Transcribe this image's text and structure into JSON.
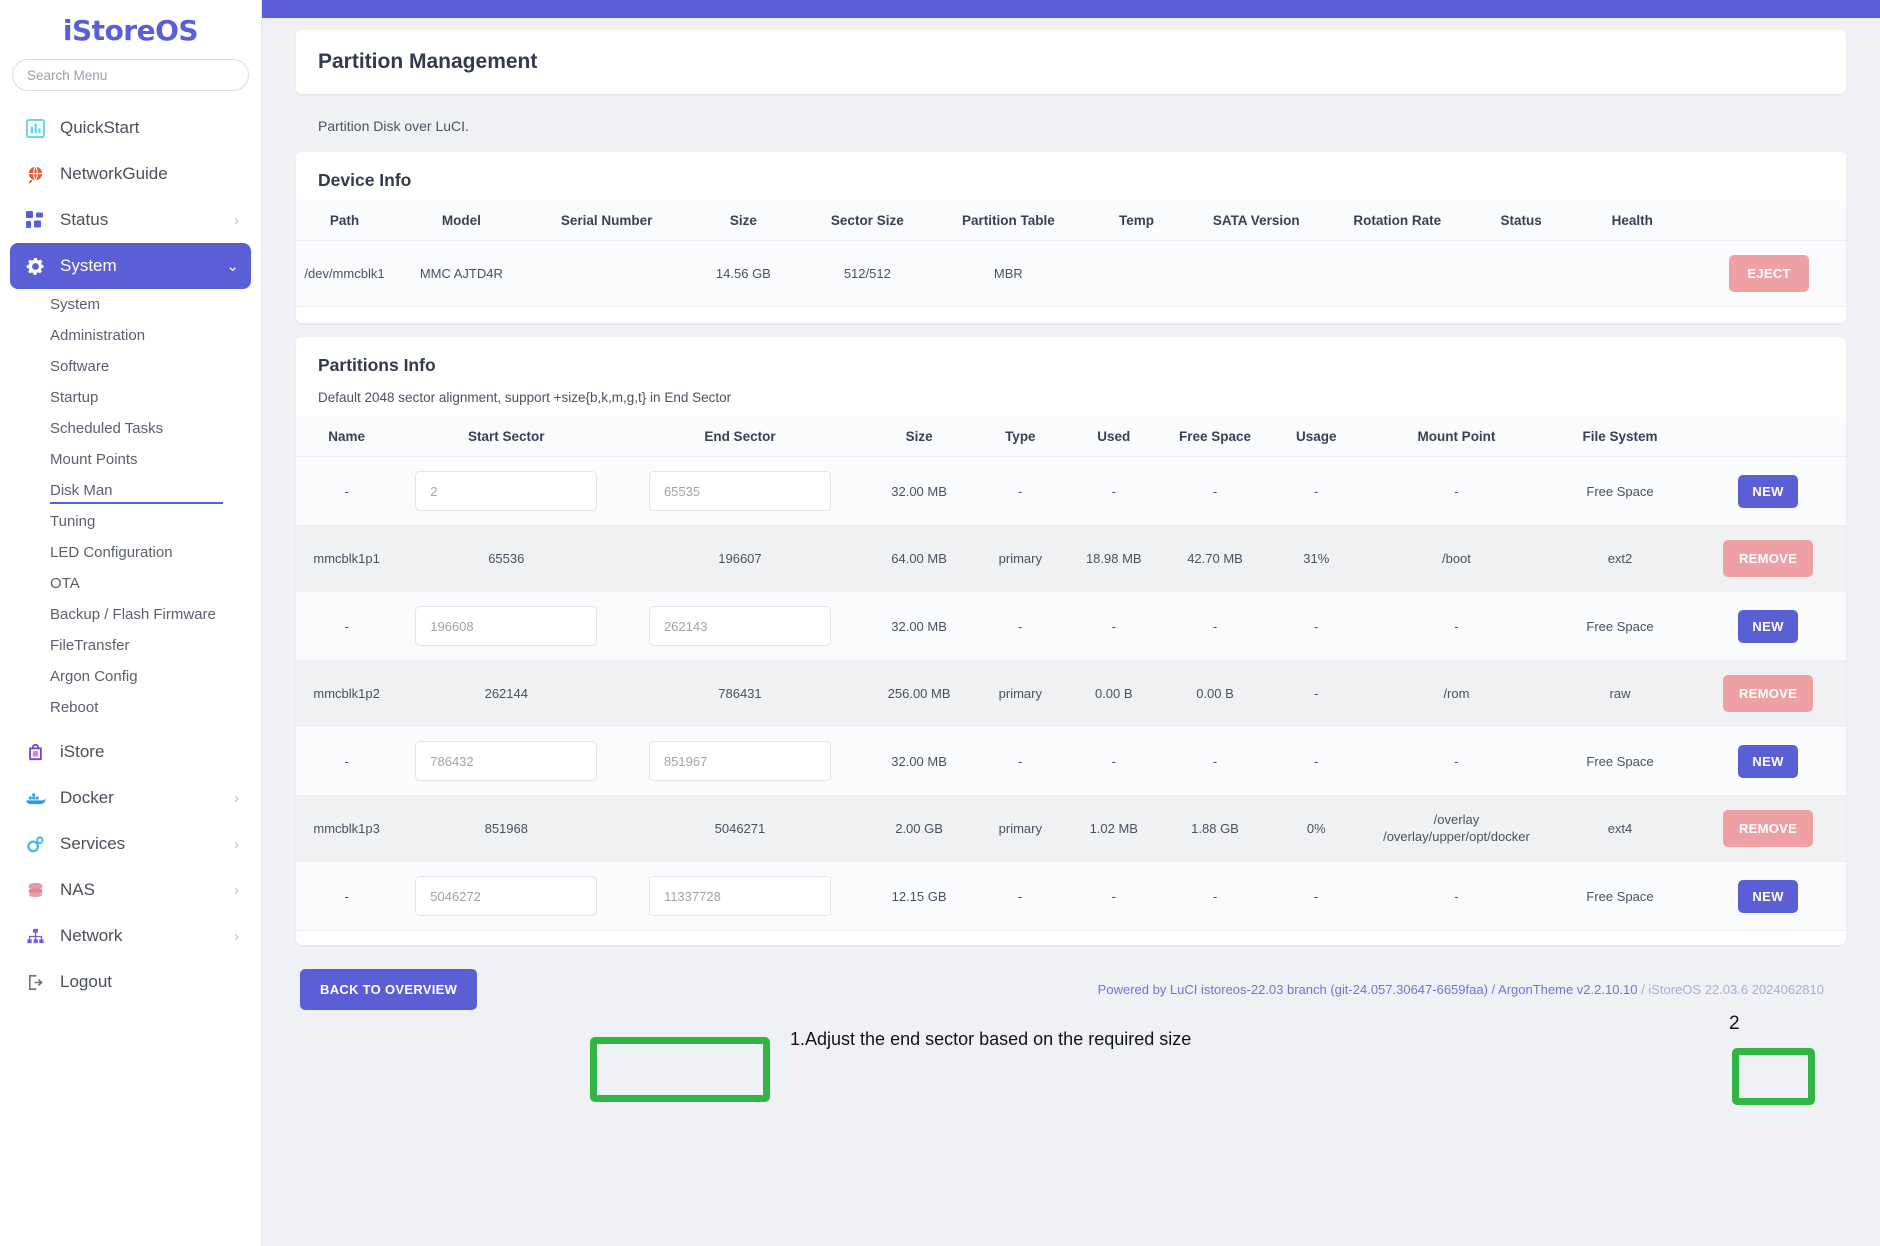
{
  "brand": {
    "logo": "iStoreOS"
  },
  "sidebar": {
    "search_placeholder": "Search Menu",
    "items": [
      {
        "label": "QuickStart",
        "icon": "chart-icon",
        "chevron": ""
      },
      {
        "label": "NetworkGuide",
        "icon": "globe-icon",
        "chevron": ""
      },
      {
        "label": "Status",
        "icon": "grid-icon",
        "chevron": "›"
      },
      {
        "label": "System",
        "icon": "gear-icon",
        "chevron": "⌄",
        "active": true
      }
    ],
    "sub_items": [
      "System",
      "Administration",
      "Software",
      "Startup",
      "Scheduled Tasks",
      "Mount Points",
      "Disk Man",
      "Tuning",
      "LED Configuration",
      "OTA",
      "Backup / Flash Firmware",
      "FileTransfer",
      "Argon Config",
      "Reboot"
    ],
    "selected_sub": "Disk Man",
    "bottom_items": [
      {
        "label": "iStore",
        "icon": "bag-icon",
        "chevron": ""
      },
      {
        "label": "Docker",
        "icon": "docker-icon",
        "chevron": "›"
      },
      {
        "label": "Services",
        "icon": "gears-icon",
        "chevron": "›"
      },
      {
        "label": "NAS",
        "icon": "database-icon",
        "chevron": "›"
      },
      {
        "label": "Network",
        "icon": "sitemap-icon",
        "chevron": "›"
      },
      {
        "label": "Logout",
        "icon": "logout-icon",
        "chevron": ""
      }
    ]
  },
  "page": {
    "title": "Partition Management",
    "description": "Partition Disk over LuCI."
  },
  "device_info": {
    "title": "Device Info",
    "columns": [
      "Path",
      "Model",
      "Serial Number",
      "Size",
      "Sector Size",
      "Partition Table",
      "Temp",
      "SATA Version",
      "Rotation Rate",
      "Status",
      "Health"
    ],
    "rows": [
      {
        "path": "/dev/mmcblk1",
        "model": "MMC AJTD4R",
        "serial": "",
        "size": "14.56 GB",
        "sector_size": "512/512",
        "partition_table": "MBR",
        "temp": "",
        "sata_version": "",
        "rotation_rate": "",
        "status": "",
        "health": "",
        "action": "EJECT"
      }
    ]
  },
  "partitions_info": {
    "title": "Partitions Info",
    "note": "Default 2048 sector alignment, support +size{b,k,m,g,t} in End Sector",
    "columns": [
      "Name",
      "Start Sector",
      "End Sector",
      "Size",
      "Type",
      "Used",
      "Free Space",
      "Usage",
      "Mount Point",
      "File System"
    ],
    "rows": [
      {
        "kind": "free",
        "name": "-",
        "start_sector": "2",
        "end_sector": "65535",
        "size": "32.00 MB",
        "type": "-",
        "used": "-",
        "free_space": "-",
        "usage": "-",
        "mount_point": "-",
        "file_system": "Free Space",
        "action": "NEW"
      },
      {
        "kind": "part",
        "name": "mmcblk1p1",
        "start_sector": "65536",
        "end_sector": "196607",
        "size": "64.00 MB",
        "type": "primary",
        "used": "18.98 MB",
        "free_space": "42.70 MB",
        "usage": "31%",
        "mount_point": "/boot",
        "file_system": "ext2",
        "action": "REMOVE"
      },
      {
        "kind": "free",
        "name": "-",
        "start_sector": "196608",
        "end_sector": "262143",
        "size": "32.00 MB",
        "type": "-",
        "used": "-",
        "free_space": "-",
        "usage": "-",
        "mount_point": "-",
        "file_system": "Free Space",
        "action": "NEW"
      },
      {
        "kind": "part",
        "name": "mmcblk1p2",
        "start_sector": "262144",
        "end_sector": "786431",
        "size": "256.00 MB",
        "type": "primary",
        "used": "0.00 B",
        "free_space": "0.00 B",
        "usage": "-",
        "mount_point": "/rom",
        "file_system": "raw",
        "action": "REMOVE"
      },
      {
        "kind": "free",
        "name": "-",
        "start_sector": "786432",
        "end_sector": "851967",
        "size": "32.00 MB",
        "type": "-",
        "used": "-",
        "free_space": "-",
        "usage": "-",
        "mount_point": "-",
        "file_system": "Free Space",
        "action": "NEW"
      },
      {
        "kind": "part",
        "name": "mmcblk1p3",
        "start_sector": "851968",
        "end_sector": "5046271",
        "size": "2.00 GB",
        "type": "primary",
        "used": "1.02 MB",
        "free_space": "1.88 GB",
        "usage": "0%",
        "mount_point": "/overlay\n/overlay/upper/opt/docker",
        "file_system": "ext4",
        "action": "REMOVE"
      },
      {
        "kind": "free",
        "name": "-",
        "start_sector": "5046272",
        "end_sector": "11337728",
        "size": "12.15 GB",
        "type": "-",
        "used": "-",
        "free_space": "-",
        "usage": "-",
        "mount_point": "-",
        "file_system": "Free Space",
        "action": "NEW"
      }
    ]
  },
  "annotations": {
    "step1": "1.Adjust the end sector based on the required size",
    "step2": "2"
  },
  "footer": {
    "back_button": "BACK TO OVERVIEW",
    "powered_main": "Powered by LuCI istoreos-22.03 branch (git-24.057.30647-6659faa) / ArgonTheme v2.2.10.10",
    "powered_dim": " / iStoreOS 22.03.6 2024062810"
  },
  "colors": {
    "accent": "#5b5fd6",
    "danger": "#efa0a5",
    "highlight": "#33b544"
  }
}
